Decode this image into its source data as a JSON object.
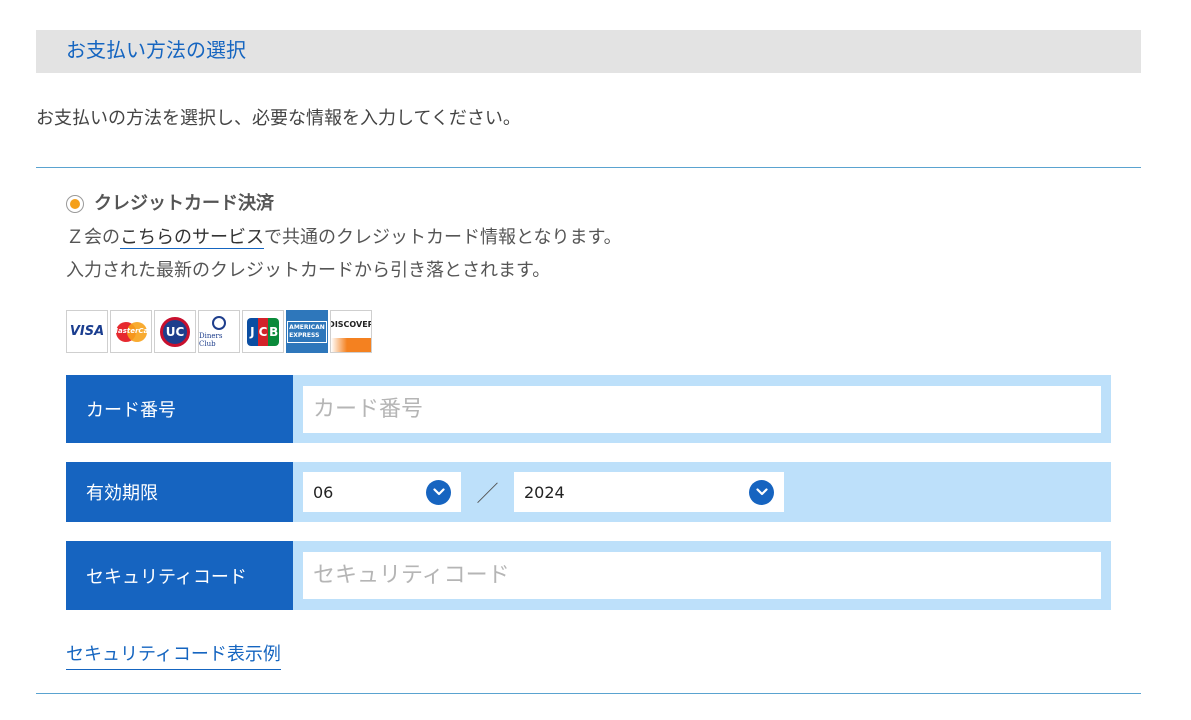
{
  "section": {
    "title": "お支払い方法の選択",
    "intro": "お支払いの方法を選択し、必要な情報を入力してください。"
  },
  "credit": {
    "radio_label": "クレジットカード決済",
    "desc_prefix": "Ｚ会の",
    "desc_link": "こちらのサービス",
    "desc_suffix": "で共通のクレジットカード情報となります。",
    "desc_line2": "入力された最新のクレジットカードから引き落とされます。",
    "brands": {
      "visa": "VISA",
      "mastercard": "MasterCard",
      "uc": "UC",
      "diners": "Diners Club",
      "jcb_j": "J",
      "jcb_c": "C",
      "jcb_b": "B",
      "amex_1": "AMERICAN",
      "amex_2": "EXPRESS",
      "discover": "DISCOVER"
    }
  },
  "form": {
    "card_number_label": "カード番号",
    "card_number_placeholder": "カード番号",
    "expiry_label": "有効期限",
    "expiry_month": "06",
    "expiry_separator": "／",
    "expiry_year": "2024",
    "cvc_label": "セキュリティコード",
    "cvc_placeholder": "セキュリティコード"
  },
  "links": {
    "cvc_example": "セキュリティコード表示例"
  },
  "colors": {
    "accent_blue": "#1664c0",
    "field_bg": "#bde0fa",
    "radio_selected": "#f5a01a",
    "header_bg": "#e3e3e3"
  },
  "icons": {
    "radio": "radio-selected-icon",
    "select_chevron": "chevron-down-icon"
  }
}
